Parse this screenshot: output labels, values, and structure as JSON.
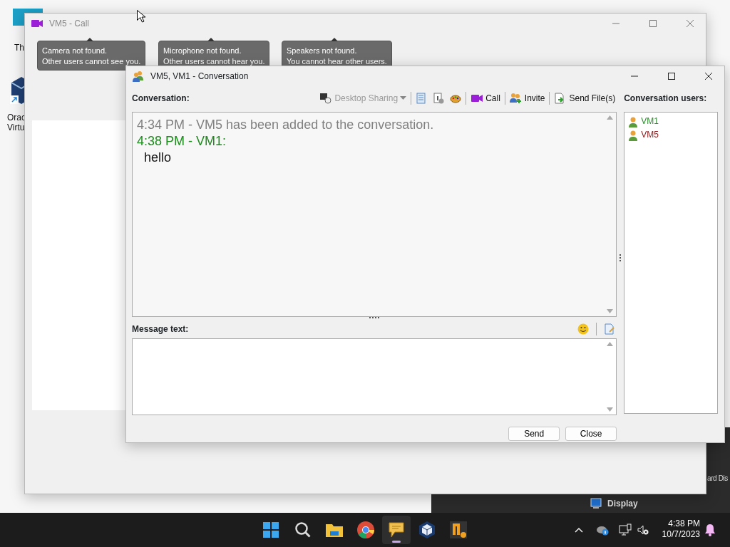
{
  "desktop": {
    "icons": [
      {
        "lines": [
          "Th"
        ]
      },
      {
        "lines": [
          "Orac",
          "Virtu"
        ]
      }
    ]
  },
  "background_window": {
    "side_text": "ard Dis",
    "display_label": "Display"
  },
  "call_window": {
    "title": "VM5 - Call",
    "notices": [
      {
        "lines": [
          "Camera not found.",
          "Other users cannot see you."
        ]
      },
      {
        "lines": [
          "Microphone not found.",
          "Other users cannot hear you."
        ]
      },
      {
        "lines": [
          "Speakers not found.",
          "You cannot hear other users."
        ]
      }
    ]
  },
  "conversation_window": {
    "title": "VM5, VM1 - Conversation",
    "conversation_label": "Conversation:",
    "toolbar": [
      {
        "kind": "dropdown",
        "label": "Desktop Sharing",
        "disabled": true
      },
      {
        "kind": "separator"
      },
      {
        "kind": "icon"
      },
      {
        "kind": "icon"
      },
      {
        "kind": "icon"
      },
      {
        "kind": "separator"
      },
      {
        "kind": "button",
        "label": "Call"
      },
      {
        "kind": "separator"
      },
      {
        "kind": "button",
        "label": "Invite"
      },
      {
        "kind": "separator"
      },
      {
        "kind": "button",
        "label": "Send File(s)"
      }
    ],
    "messages": [
      {
        "kind": "system",
        "text": "4:34 PM - VM5 has been added to the conversation."
      },
      {
        "kind": "header",
        "text": "4:38 PM - VM1:"
      },
      {
        "kind": "body",
        "text": "hello"
      }
    ],
    "users_label": "Conversation users:",
    "users": [
      {
        "name": "VM1",
        "color": "#2e8b2e"
      },
      {
        "name": "VM5",
        "color": "#8b1a1a"
      }
    ],
    "message_label": "Message text:",
    "buttons": [
      "Send",
      "Close"
    ]
  },
  "taskbar": {
    "apps": [
      {
        "active": false
      },
      {
        "active": false
      },
      {
        "active": false
      },
      {
        "active": false
      },
      {
        "active": true
      },
      {
        "active": false
      },
      {
        "active": false
      }
    ],
    "time": "4:38 PM",
    "date": "10/7/2023"
  }
}
